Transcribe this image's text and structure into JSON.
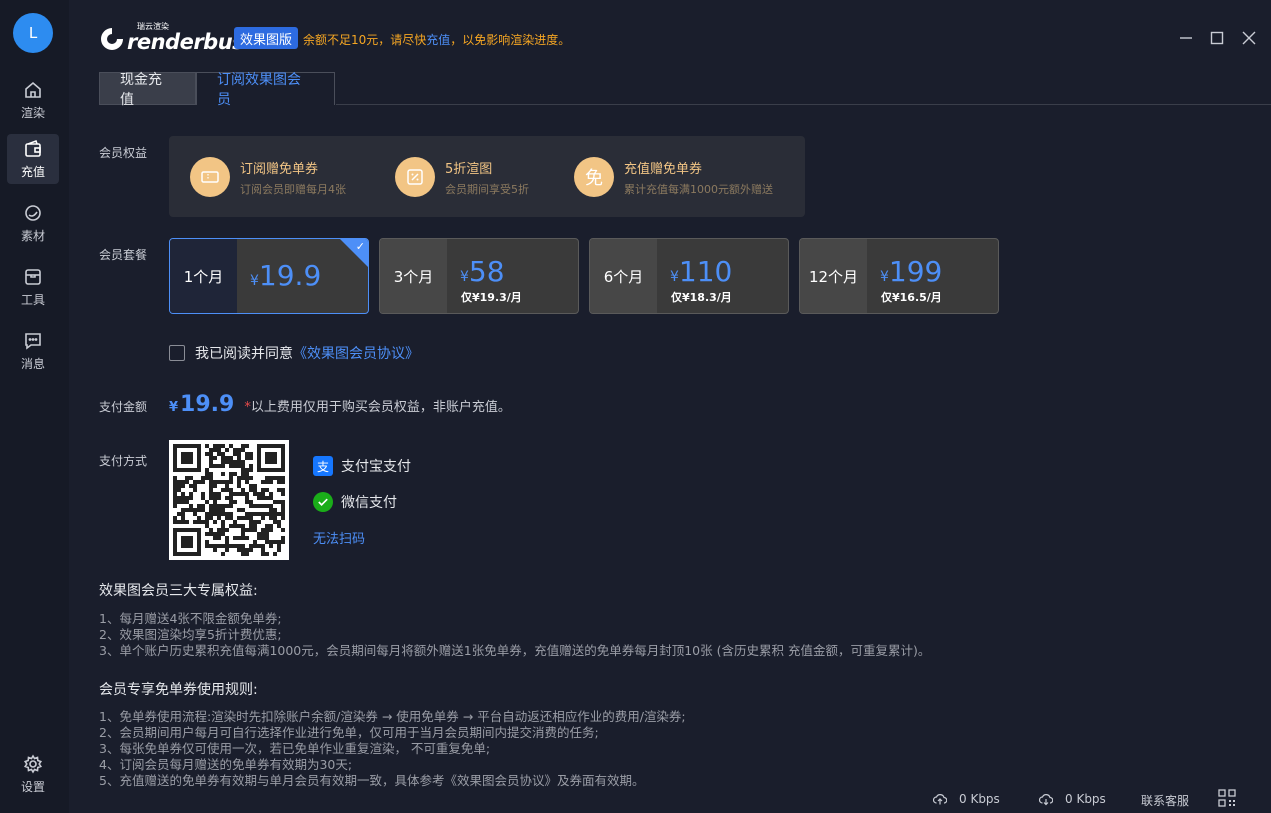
{
  "user": {
    "avatar_letter": "L"
  },
  "sidebar": {
    "items": [
      {
        "label": "渲染",
        "icon": "home-icon"
      },
      {
        "label": "充值",
        "icon": "wallet-icon"
      },
      {
        "label": "素材",
        "icon": "material-icon"
      },
      {
        "label": "工具",
        "icon": "toolbox-icon"
      },
      {
        "label": "消息",
        "icon": "message-icon"
      }
    ],
    "settings_label": "设置"
  },
  "header": {
    "logo_text": "renderbus",
    "logo_sub": "瑞云渲染",
    "mode_badge": "效果图版",
    "warning_prefix": "余额不足10元，请尽快",
    "warning_link": "充值",
    "warning_suffix": "，以免影响渲染进度。"
  },
  "tabs": [
    {
      "label": "现金充值"
    },
    {
      "label": "订阅效果图会员"
    }
  ],
  "benefits": {
    "label": "会员权益",
    "items": [
      {
        "title": "订阅赠免单券",
        "desc": "订阅会员即赠每月4张",
        "icon": "ticket-icon"
      },
      {
        "title": "5折渲图",
        "desc": "会员期间享受5折",
        "icon": "percent-icon"
      },
      {
        "title": "充值赠免单券",
        "desc": "累计充值每满1000元额外赠送",
        "icon": "free-icon",
        "glyph": "免"
      }
    ]
  },
  "plans": {
    "label": "会员套餐",
    "currency": "¥",
    "items": [
      {
        "duration": "1个月",
        "price": "19.9",
        "unit_price": "",
        "selected": true
      },
      {
        "duration": "3个月",
        "price": "58",
        "unit_price": "仅¥19.3/月",
        "selected": false
      },
      {
        "duration": "6个月",
        "price": "110",
        "unit_price": "仅¥18.3/月",
        "selected": false
      },
      {
        "duration": "12个月",
        "price": "199",
        "unit_price": "仅¥16.5/月",
        "selected": false
      }
    ]
  },
  "agreement": {
    "text": "我已阅读并同意",
    "link": "《效果图会员协议》",
    "checked": false
  },
  "payment": {
    "amount_label": "支付金额",
    "currency": "¥",
    "amount": "19.9",
    "note_star": "*",
    "note": "以上费用仅用于购买会员权益，非账户充值。",
    "method_label": "支付方式",
    "methods": [
      {
        "label": "支付宝支付",
        "icon": "alipay-icon",
        "color": "#1677ff"
      },
      {
        "label": "微信支付",
        "icon": "wechat-icon",
        "color": "#1aad19"
      }
    ],
    "cant_scan": "无法扫码"
  },
  "rules": {
    "benefits_title": "效果图会员三大专属权益:",
    "benefits_lines": [
      "1、每月赠送4张不限金额免单券;",
      "2、效果图渲染均享5折计费优惠;",
      "3、单个账户历史累积充值每满1000元，会员期间每月将额外赠送1张免单券，充值赠送的免单券每月封顶10张 (含历史累积 充值金额，可重复累计)。"
    ],
    "usage_title": "会员专享免单券使用规则:",
    "usage_lines": [
      "1、免单券使用流程:渲染时先扣除账户余额/渲染券 → 使用免单券 → 平台自动返还相应作业的费用/渲染券;",
      "2、会员期间用户每月可自行选择作业进行免单，仅可用于当月会员期间内提交消费的任务;",
      "3、每张免单券仅可使用一次，若已免单作业重复渲染， 不可重复免单;",
      "4、订阅会员每月赠送的免单券有效期为30天;",
      "5、充值赠送的免单券有效期与单月会员有效期一致，具体参考《效果图会员协议》及券面有效期。"
    ]
  },
  "status_bar": {
    "upload_speed": "0 Kbps",
    "download_speed": "0 Kbps",
    "support": "联系客服"
  }
}
